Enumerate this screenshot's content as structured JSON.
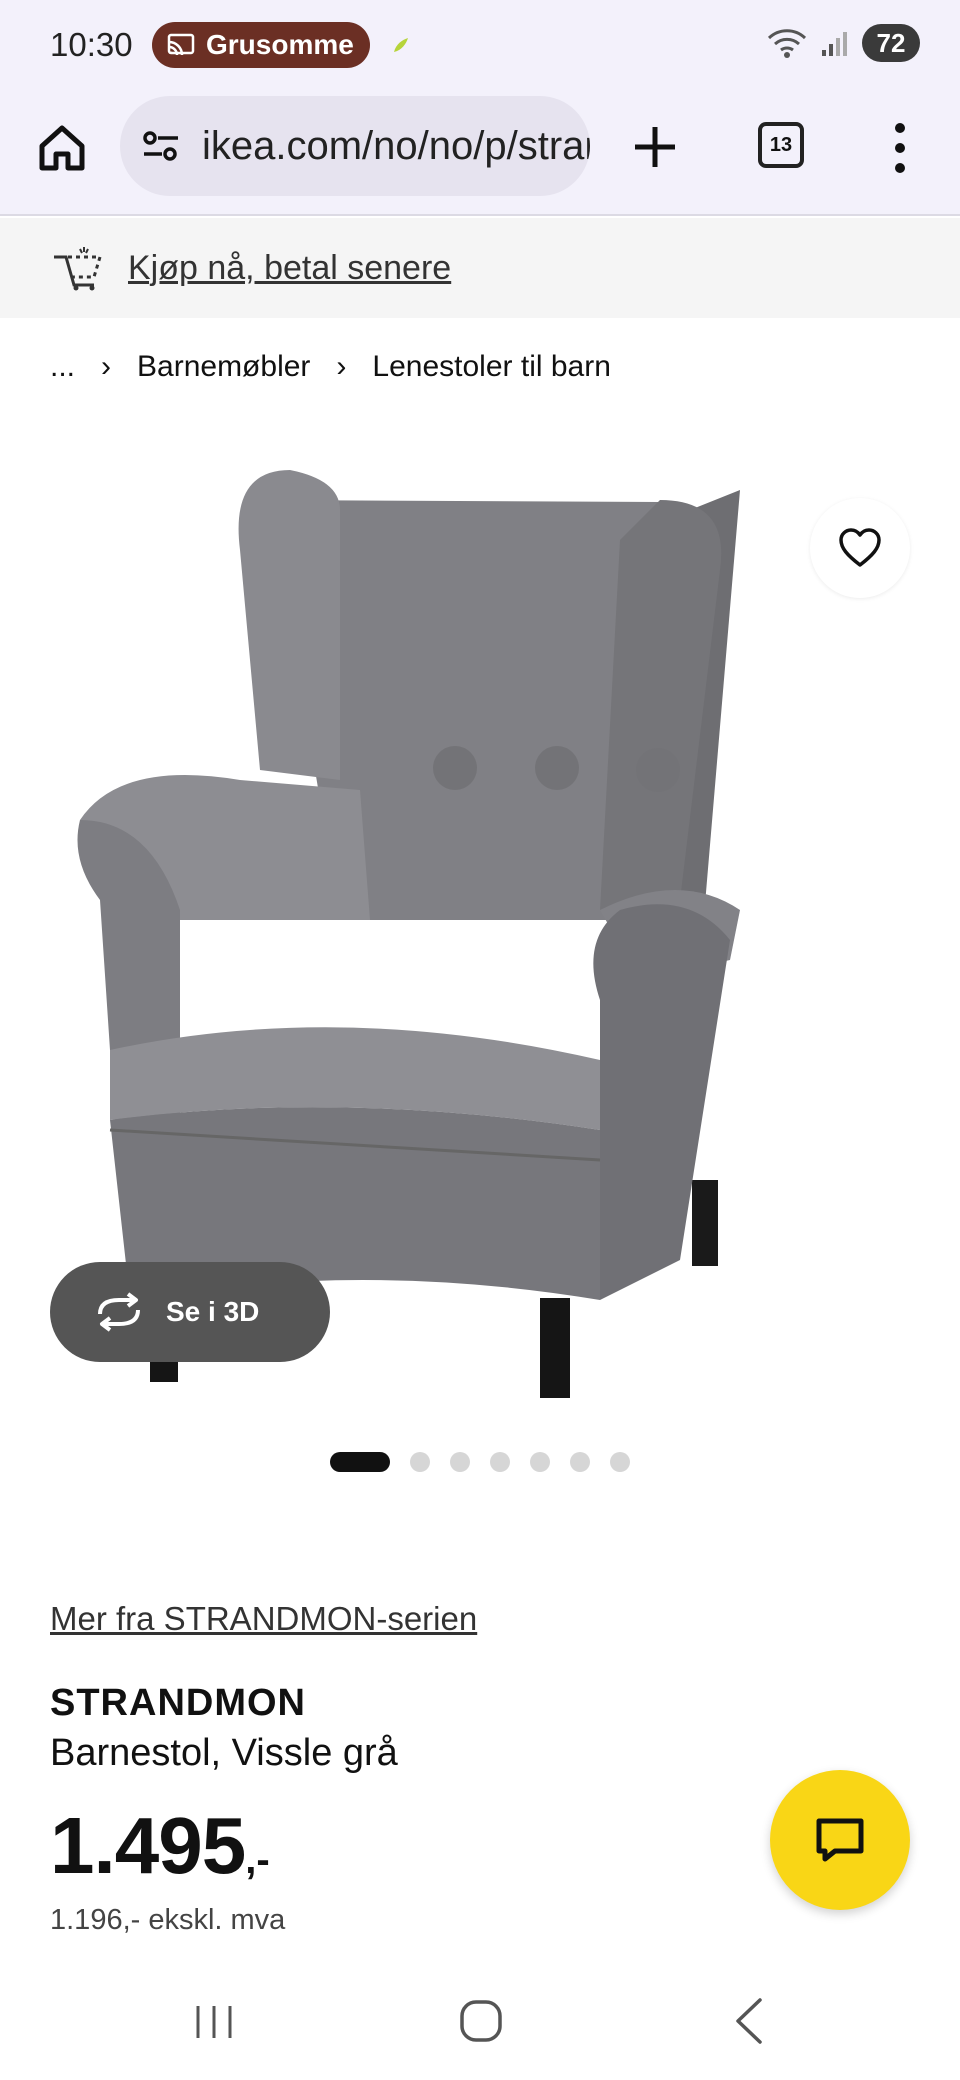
{
  "status_bar": {
    "time": "10:30",
    "cast_label": "Grusomme",
    "battery": "72"
  },
  "browser": {
    "url": "ikea.com/no/no/p/strandmon-barnestol",
    "tab_count": "13"
  },
  "banner": {
    "text": "Kjøp nå, betal senere"
  },
  "breadcrumb": {
    "ellipsis": "...",
    "items": [
      "Barnemøbler",
      "Lenestoler til barn"
    ]
  },
  "gallery": {
    "see_3d_label": "Se i 3D",
    "image_count": 7,
    "active_index": 0
  },
  "product": {
    "series_link": "Mer fra STRANDMON-serien",
    "name": "STRANDMON",
    "description": "Barnestol, Vissle grå",
    "price_int": "1.495",
    "price_suffix": ",-",
    "price_ex_vat": "1.196,- ekskl. mva"
  },
  "colors": {
    "chat_button": "#f9d616",
    "toolbar_bg": "#f3f1fb",
    "cast_pill": "#6b2f24"
  }
}
